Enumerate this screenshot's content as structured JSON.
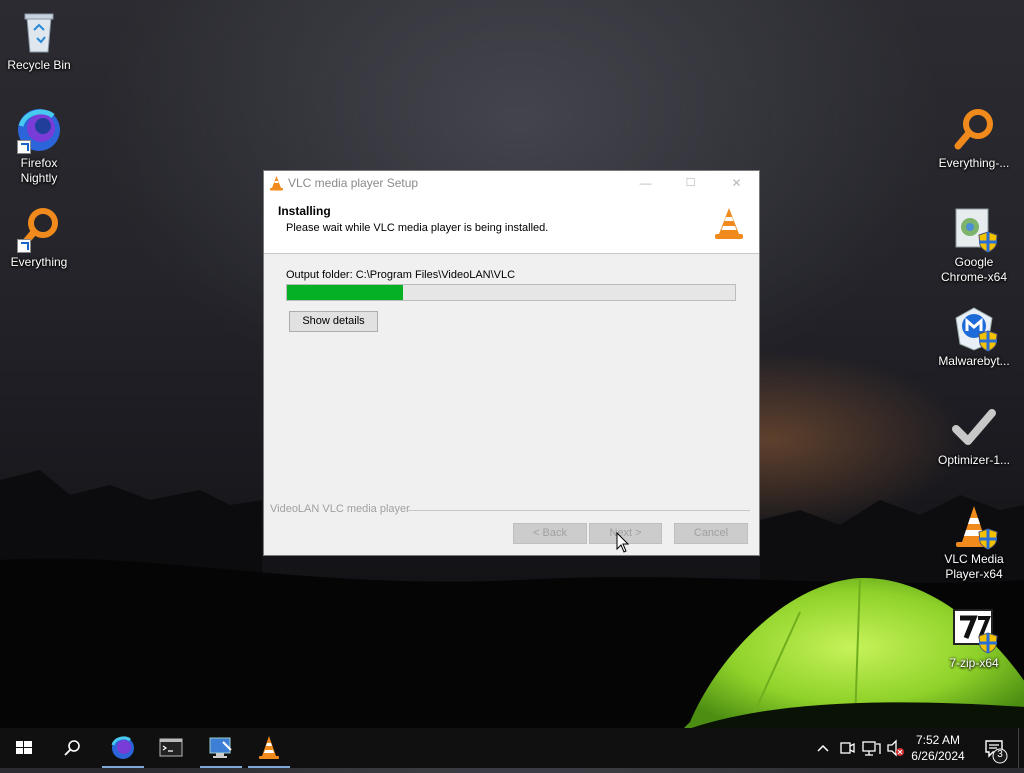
{
  "desktop": {
    "left_icons": [
      {
        "label": "Recycle Bin"
      },
      {
        "label": "Firefox Nightly"
      },
      {
        "label": "Everything"
      }
    ],
    "right_icons": [
      {
        "label": "Everything-..."
      },
      {
        "label": "Google Chrome-x64"
      },
      {
        "label": "Malwarebyt..."
      },
      {
        "label": "Optimizer-1..."
      },
      {
        "label": "VLC Media Player-x64"
      },
      {
        "label": "7-zip-x64"
      }
    ]
  },
  "installer": {
    "title": "VLC media player Setup",
    "controls": {
      "minimize": "—",
      "maximize": "☐",
      "close": "✕"
    },
    "header_title": "Installing",
    "header_subtitle": "Please wait while VLC media player is being installed.",
    "output_folder": "Output folder: C:\\Program Files\\VideoLAN\\VLC",
    "progress": 0.26,
    "show_details_label": "Show details",
    "brand": "VideoLAN VLC media player",
    "back_label": "< Back",
    "next_label": "Next >",
    "cancel_label": "Cancel",
    "accent_color": "#06b025"
  },
  "taskbar": {
    "pinned": [
      "start-icon",
      "search-icon",
      "firefox-nightly-icon",
      "terminal-icon",
      "remote-desktop-icon",
      "vlc-icon"
    ],
    "time": "7:52 AM",
    "date": "6/26/2024",
    "notification_count": "3"
  }
}
